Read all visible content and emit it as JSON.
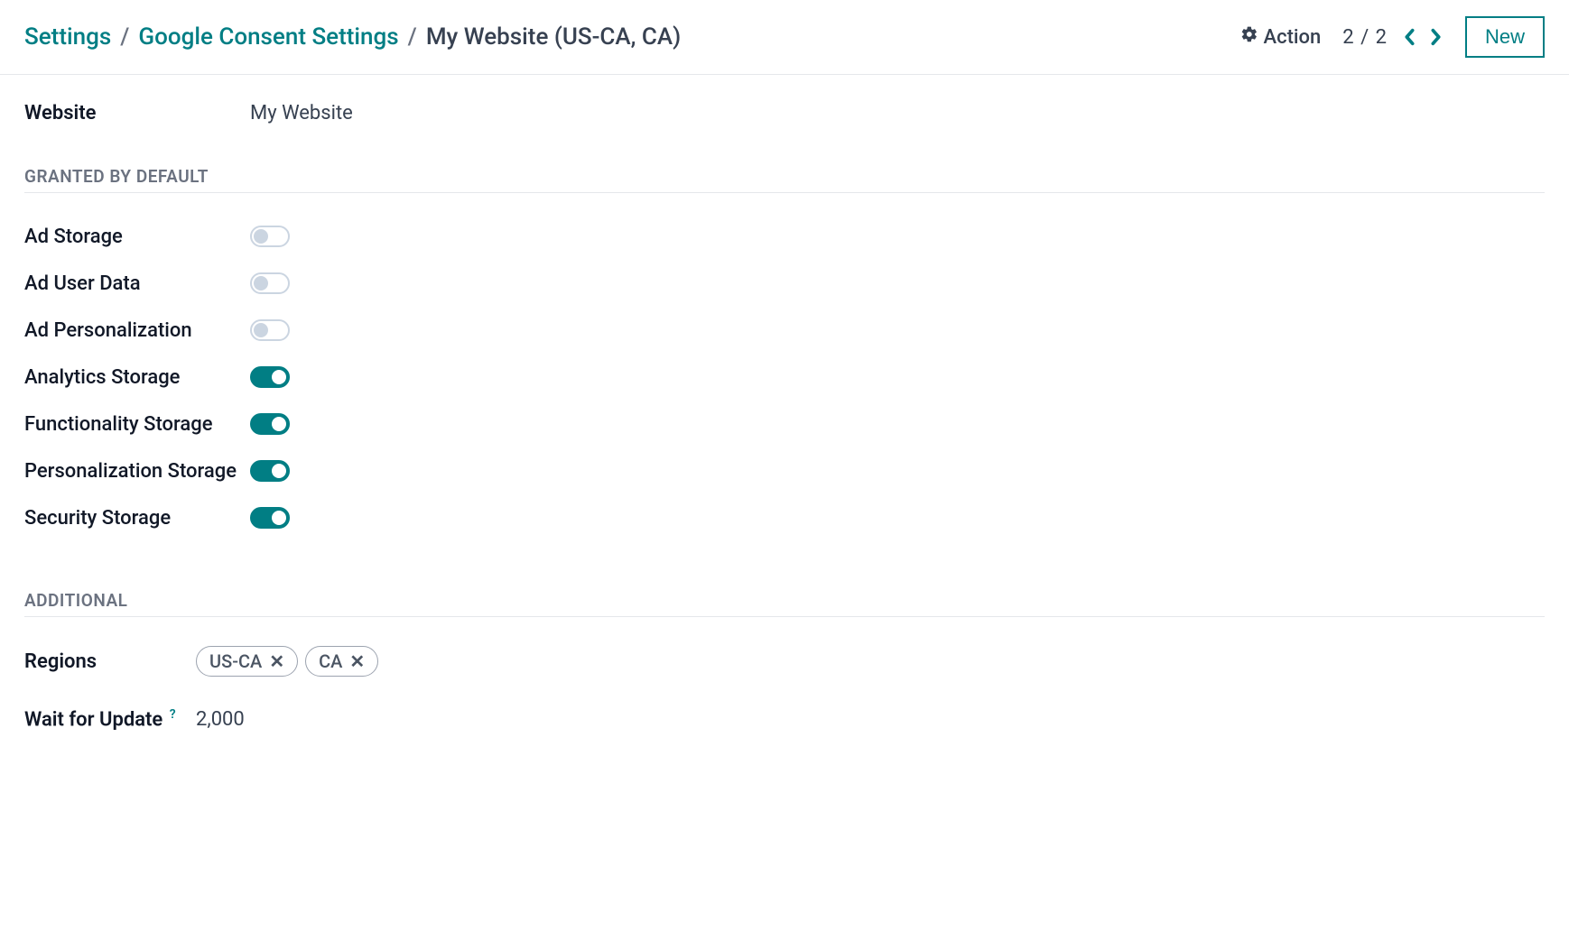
{
  "colors": {
    "accent": "#017e84"
  },
  "breadcrumb": {
    "root": "Settings",
    "mid": "Google Consent Settings",
    "current": "My Website (US-CA, CA)",
    "sep": "/"
  },
  "header": {
    "action_label": "Action",
    "pager_text": "2 / 2",
    "new_label": "New"
  },
  "form": {
    "website": {
      "label": "Website",
      "value": "My Website"
    }
  },
  "sections": {
    "granted_title": "Granted by default",
    "additional_title": "Additional"
  },
  "defaults": [
    {
      "label": "Ad Storage",
      "on": false
    },
    {
      "label": "Ad User Data",
      "on": false
    },
    {
      "label": "Ad Personalization",
      "on": false
    },
    {
      "label": "Analytics Storage",
      "on": true
    },
    {
      "label": "Functionality Storage",
      "on": true
    },
    {
      "label": "Personalization Storage",
      "on": true
    },
    {
      "label": "Security Storage",
      "on": true
    }
  ],
  "additional": {
    "regions_label": "Regions",
    "regions": [
      "US-CA",
      "CA"
    ],
    "wait_label": "Wait for Update",
    "wait_help": "?",
    "wait_value": "2,000"
  }
}
